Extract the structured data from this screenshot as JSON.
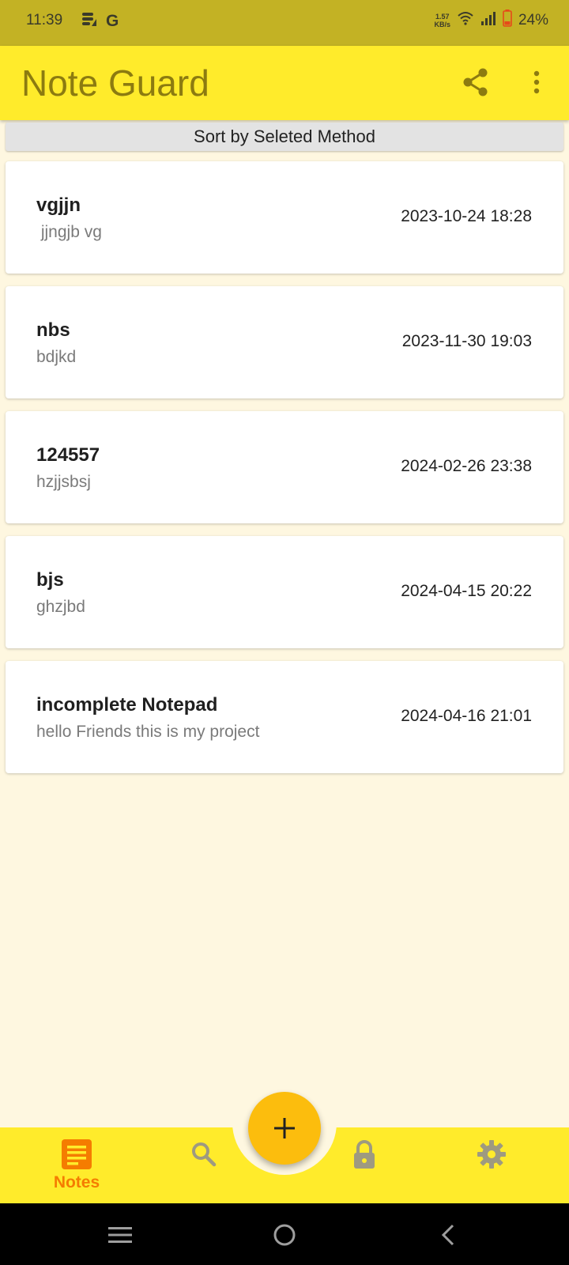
{
  "status_bar": {
    "time": "11:39",
    "carrier_glyph": "G",
    "speed_value": "1.57",
    "speed_unit": "KB/s",
    "battery": "24%"
  },
  "app_bar": {
    "title": "Note Guard",
    "actions": [
      "share-icon",
      "more-vert-icon"
    ]
  },
  "sort": {
    "label": "Sort by Seleted Method"
  },
  "notes": [
    {
      "title": "vgjjn",
      "body": " jjngjb vg",
      "date": "2023-10-24 18:28"
    },
    {
      "title": "nbs",
      "body": "bdjkd",
      "date": "2023-11-30 19:03"
    },
    {
      "title": "124557",
      "body": "hzjjsbsj",
      "date": "2024-02-26 23:38"
    },
    {
      "title": "bjs",
      "body": "ghzjbd",
      "date": "2024-04-15 20:22"
    },
    {
      "title": "incomplete Notepad",
      "body": "hello Friends this is my project",
      "date": "2024-04-16 21:01"
    }
  ],
  "bottom_nav": {
    "items": [
      {
        "label": "Notes",
        "icon": "notes-icon",
        "active": true
      },
      {
        "label": "",
        "icon": "search-icon",
        "active": false
      },
      {
        "label": "",
        "icon": "lock-icon",
        "active": false
      },
      {
        "label": "",
        "icon": "gear-icon",
        "active": false
      }
    ],
    "fab_icon": "plus-icon"
  },
  "colors": {
    "status_bar": "#c3b224",
    "app_bar": "#ffeb2b",
    "title_text": "#8c7b10",
    "background": "#fef7e0",
    "fab": "#fcbd0d",
    "active_nav": "#f57c00",
    "inactive_nav": "#9e9a80"
  }
}
